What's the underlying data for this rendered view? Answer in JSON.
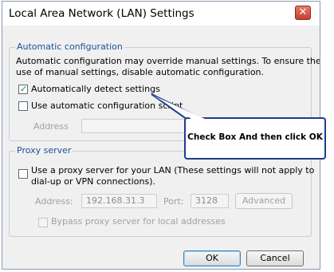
{
  "window": {
    "title": "Local Area Network (LAN) Settings",
    "close_glyph": "✕"
  },
  "auto_config": {
    "legend": "Automatic configuration",
    "description_line1": "Automatic configuration may override manual settings.  To ensure the",
    "description_line2": "use of manual settings, disable automatic configuration.",
    "detect_label": "Automatically detect settings",
    "detect_checked": true,
    "script_label": "Use automatic configuration script",
    "script_checked": false,
    "address_label": "Address"
  },
  "proxy": {
    "legend": "Proxy server",
    "use_proxy_line1": "Use a proxy server for your LAN (These settings will not apply to",
    "use_proxy_line2": "dial-up or VPN connections).",
    "use_proxy_checked": false,
    "address_label": "Address:",
    "address_value": "192.168.31.3",
    "port_label": "Port:",
    "port_value": "3128",
    "advanced_label": "Advanced",
    "bypass_label": "Bypass proxy server for local addresses",
    "bypass_checked": false
  },
  "buttons": {
    "ok": "OK",
    "cancel": "Cancel"
  },
  "callout": {
    "text": "Check Box And then click OK"
  },
  "colors": {
    "callout_border": "#1c3d8c",
    "legend_text": "#1e4f99"
  }
}
